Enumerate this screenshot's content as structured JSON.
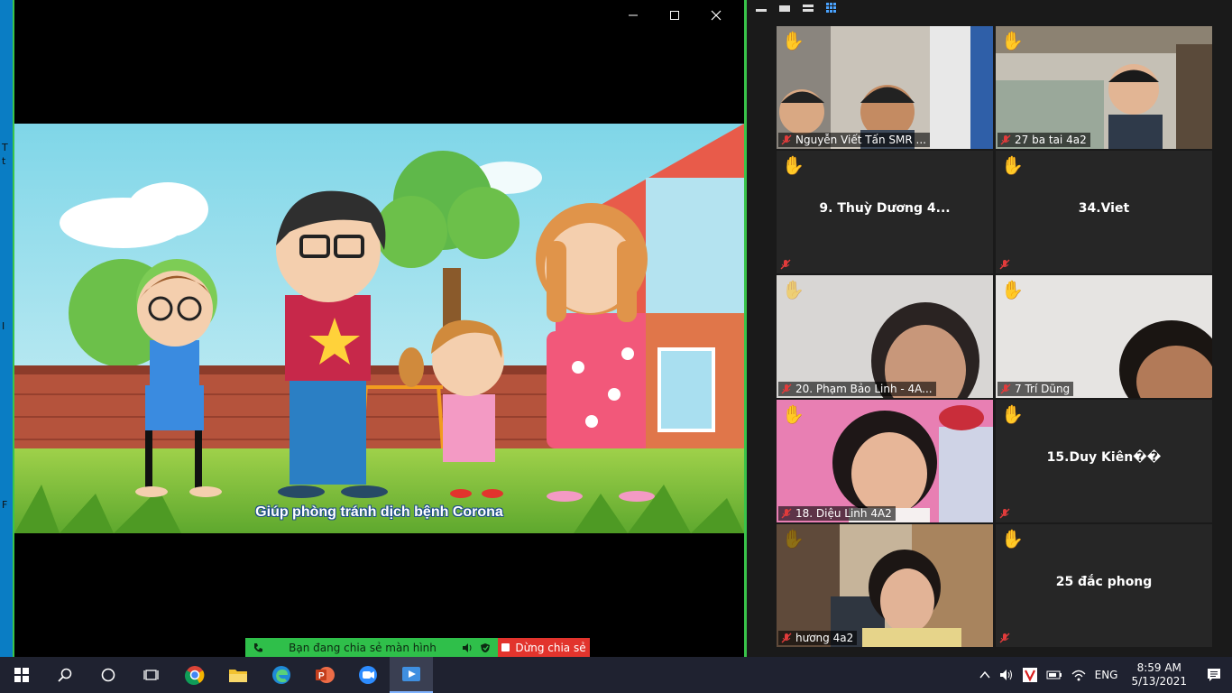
{
  "desktop_left": {
    "letters": [
      "T",
      "t",
      "I",
      "F"
    ]
  },
  "video": {
    "caption": "Giúp phòng tránh dịch bệnh Corona"
  },
  "share_bar": {
    "status_label": "Bạn đang chia sẻ màn hình",
    "stop_label": "Dừng chia sẻ"
  },
  "gallery": {
    "participants": [
      {
        "name": "Nguyễn Viết Tấn SMR ...",
        "video": true,
        "hand": "yellow"
      },
      {
        "name": "27  ba tai 4a2",
        "video": true,
        "hand": "yellow"
      },
      {
        "name": "9. Thuỳ Dương 4...",
        "video": false,
        "hand": "yellow"
      },
      {
        "name": "34.Viet",
        "video": false,
        "hand": "yellow"
      },
      {
        "name": "20. Phạm Bảo Linh - 4A...",
        "video": true,
        "hand": "light"
      },
      {
        "name": "7 Trí Dũng",
        "video": true,
        "hand": "yellow"
      },
      {
        "name": "18. Diệu Linh 4A2",
        "video": true,
        "hand": "yellow"
      },
      {
        "name": "15.Duy  Kiên��",
        "video": false,
        "hand": "yellow"
      },
      {
        "name": "hương 4a2",
        "video": true,
        "hand": "brown"
      },
      {
        "name": "25 đắc phong",
        "video": false,
        "hand": "yellow"
      }
    ]
  },
  "taskbar": {
    "language": "ENG",
    "time": "8:59 AM",
    "date": "5/13/2021"
  },
  "colors": {
    "share_green": "#2fbf4a",
    "stop_red": "#e2342d",
    "window_border": "#39c44a"
  }
}
